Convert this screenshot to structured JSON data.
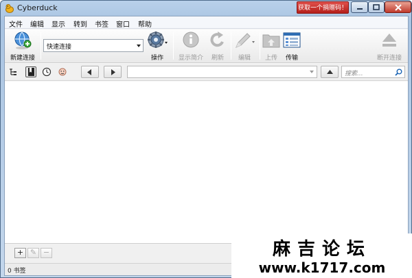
{
  "window": {
    "title": "Cyberduck",
    "promo": "获取一个捐赠码！"
  },
  "menu": [
    "文件",
    "编辑",
    "显示",
    "转到",
    "书签",
    "窗口",
    "帮助"
  ],
  "toolbar": {
    "new_connection": "新建连接",
    "quick_connect": "快速连接",
    "action": "操作",
    "info": "显示简介",
    "refresh": "刷新",
    "edit": "编辑",
    "upload": "上传",
    "transfers": "传输",
    "disconnect": "断开连接"
  },
  "navbar": {
    "search_placeholder": "搜索..."
  },
  "bottombar": {
    "add": "+",
    "edit": "✎",
    "remove": "−"
  },
  "status": {
    "text": "0 书签"
  },
  "watermark": {
    "line1": "麻吉论坛",
    "line2": "www.k1717.com"
  },
  "colors": {
    "accent": "#1c65b4",
    "promo": "#c62b24",
    "disabled": "#9a9a9a"
  }
}
